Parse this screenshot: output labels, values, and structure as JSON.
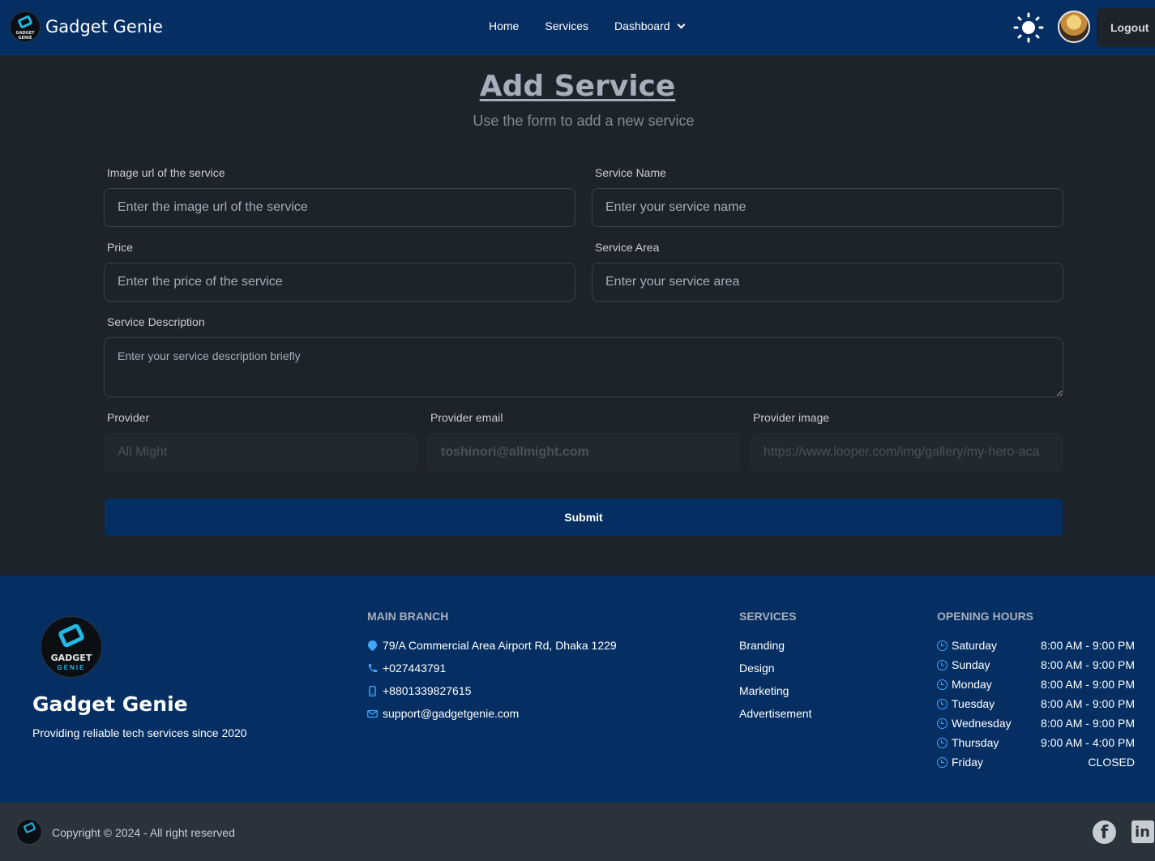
{
  "nav": {
    "brand": "Gadget Genie",
    "links": [
      "Home",
      "Services",
      "Dashboard"
    ],
    "logout_label": "Logout",
    "logo_text": "GADGET GENIE"
  },
  "page": {
    "title": "Add Service",
    "subtitle": "Use the form to add a new service"
  },
  "form": {
    "image_label": "Image url of the service",
    "image_placeholder": "Enter the image url of the service",
    "name_label": "Service Name",
    "name_placeholder": "Enter your service name",
    "price_label": "Price",
    "price_placeholder": "Enter the price of the service",
    "area_label": "Service Area",
    "area_placeholder": "Enter your service area",
    "desc_label": "Service Description",
    "desc_placeholder": "Enter your service description briefly",
    "provider_label": "Provider",
    "provider_value": "All Might",
    "email_label": "Provider email",
    "email_value": "toshinori@allmight.com",
    "pimage_label": "Provider image",
    "pimage_value": "https://www.looper.com/img/gallery/my-hero-aca",
    "submit_label": "Submit"
  },
  "footer": {
    "logo_line1": "GADGET",
    "logo_line2": "GENIE",
    "brand": "Gadget Genie",
    "tagline": "Providing reliable tech services since 2020",
    "branch_heading": "MAIN BRANCH",
    "address": "79/A Commercial Area Airport Rd, Dhaka 1229",
    "phone": "+027443791",
    "mobile": "+8801339827615",
    "email": "support@gadgetgenie.com",
    "services_heading": "SERVICES",
    "services": [
      "Branding",
      "Design",
      "Marketing",
      "Advertisement"
    ],
    "hours_heading": "OPENING HOURS",
    "hours": [
      {
        "day": "Saturday",
        "time": "8:00 AM - 9:00 PM"
      },
      {
        "day": "Sunday",
        "time": "8:00 AM - 9:00 PM"
      },
      {
        "day": "Monday",
        "time": "8:00 AM - 9:00 PM"
      },
      {
        "day": "Tuesday",
        "time": "8:00 AM - 9:00 PM"
      },
      {
        "day": "Wednesday",
        "time": "8:00 AM - 9:00 PM"
      },
      {
        "day": "Thursday",
        "time": "9:00 AM - 4:00 PM"
      },
      {
        "day": "Friday",
        "time": "CLOSED"
      }
    ],
    "copyright": "Copyright © 2024 - All right reserved"
  },
  "colors": {
    "nav_bg": "#052f63",
    "page_bg": "#1d232a",
    "accent": "#3fa7ff"
  },
  "icons": [
    "sun-icon",
    "avatar",
    "location-pin-icon",
    "phone-icon",
    "mobile-icon",
    "mail-icon",
    "clock-icon",
    "facebook-icon",
    "linkedin-icon"
  ]
}
